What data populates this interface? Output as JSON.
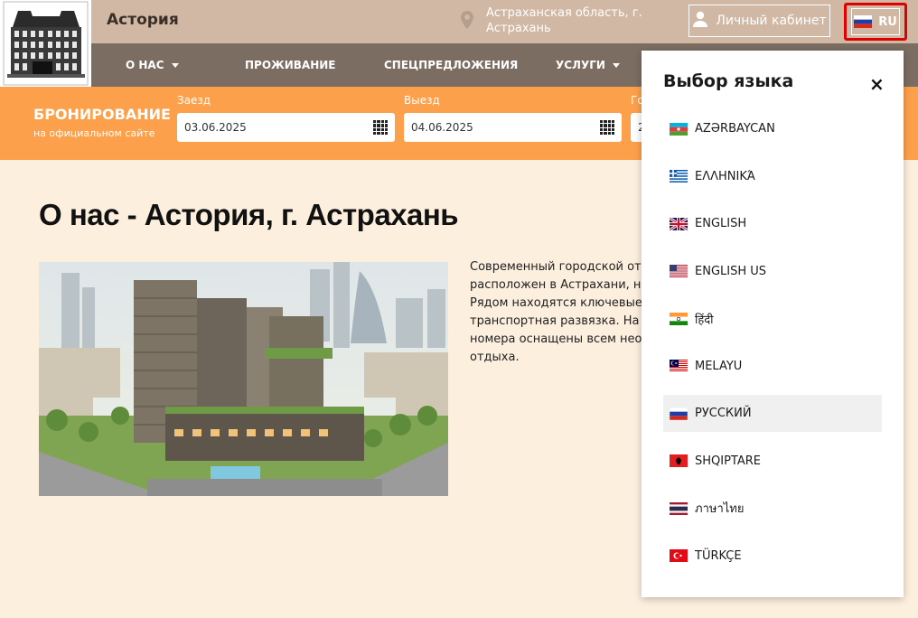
{
  "header": {
    "hotel_name": "Астория",
    "location": "Астраханская область, г. Астрахань",
    "cabinet_label": "Личный кабинет",
    "language_code": "RU"
  },
  "nav": {
    "items": [
      {
        "label": "О НАС",
        "dropdown": true
      },
      {
        "label": "ПРОЖИВАНИЕ",
        "dropdown": false
      },
      {
        "label": "СПЕЦПРЕДЛОЖЕНИЯ",
        "dropdown": false
      },
      {
        "label": "УСЛУГИ",
        "dropdown": true
      }
    ]
  },
  "booking": {
    "title": "БРОНИРОВАНИЕ",
    "subtitle": "на официальном сайте",
    "checkin_label": "Заезд",
    "checkin_value": "03.06.2025",
    "checkout_label": "Выезд",
    "checkout_value": "04.06.2025",
    "guests_label": "Го",
    "guests_value": "2"
  },
  "main": {
    "title": "О нас - Астория, г. Астрахань",
    "about_lines": [
      "Современный городской отел",
      "расположен в Астрахани, неда",
      "Рядом находятся ключевые до",
      "транспортная развязка. На тер",
      "номера оснащены всем необх",
      "отдыха."
    ]
  },
  "language_panel": {
    "title": "Выбор языка",
    "close_icon": "×",
    "languages": [
      {
        "label": "AZƏRBAYCAN",
        "flag": "az-flag-icon",
        "active": false
      },
      {
        "label": "ΕΛΛΗΝΙΚΆ",
        "flag": "gr-flag-icon",
        "active": false
      },
      {
        "label": "ENGLISH",
        "flag": "gb-flag-icon",
        "active": false
      },
      {
        "label": "ENGLISH US",
        "flag": "us-flag-icon",
        "active": false
      },
      {
        "label": "हिंदी",
        "flag": "in-flag-icon",
        "active": false
      },
      {
        "label": "MELAYU",
        "flag": "my-flag-icon",
        "active": false
      },
      {
        "label": "РУССКИЙ",
        "flag": "ru-flag-icon",
        "active": true
      },
      {
        "label": "SHQIPTARE",
        "flag": "al-flag-icon",
        "active": false
      },
      {
        "label": "ภาษาไทย",
        "flag": "th-flag-icon",
        "active": false
      },
      {
        "label": "TÜRKÇE",
        "flag": "tr-flag-icon",
        "active": false
      }
    ]
  },
  "colors": {
    "topbar": "#d1b8a5",
    "navbar": "#7b6d62",
    "booking_bar": "#fda04b",
    "page_bg": "#fdefde",
    "highlight": "#e00000"
  }
}
